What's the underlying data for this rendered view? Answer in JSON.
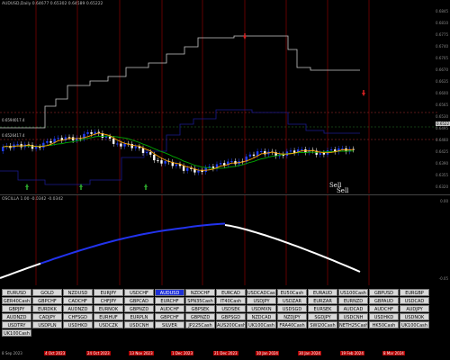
{
  "chart": {
    "title": "AUDUSD,Daily  0.64677 0.65302 0.64589 0.65222",
    "oscillator_title": "OSCILLA 1.00 -0.0342 -0.0342",
    "level_label_1": "0.6594017.4",
    "level_label_2": "0.6526417.4",
    "sell_labels": [
      "Sell",
      "Sell"
    ],
    "price_ticks": [
      "0.6845",
      "0.6810",
      "0.6775",
      "0.6740",
      "0.6705",
      "0.6670",
      "0.6635",
      "0.6600",
      "0.6565",
      "0.6530",
      "0.6495",
      "0.6460",
      "0.6425",
      "0.6390",
      "0.6355",
      "0.6320"
    ],
    "osc_ticks": [
      "0.00",
      "-0.05"
    ],
    "current_price": "0.6522",
    "time_labels": [
      "8 Sep 2023",
      "4 Oct 2023",
      "24 Oct 2023",
      "13 Nov 2023",
      "1 Dec 2023",
      "21 Dec 2023",
      "10 Jan 2024",
      "30 Jan 2024",
      "19 Feb 2024",
      "8 Mar 2024"
    ],
    "colors": {
      "bull_candle": "#2040ff",
      "bear_candle": "#ffffff",
      "envelope": "#c8c8c8",
      "ma_fast": "#ffa500",
      "ma_slow": "#00aa00",
      "osc_line_up": "#2233ee",
      "osc_line_down": "#ffffff",
      "vline": "#8b0000",
      "active_button": "#1d2fd6"
    }
  },
  "symbols": [
    "EURUSD",
    "GOLD",
    "NZDUSD",
    "EURJPY",
    "USDCHF",
    "AUDUSD",
    "NZDCHF",
    "EURCAD",
    "USDCADCash",
    "EU50Cash",
    "EURAUD",
    "US100Cash",
    "GBPUSD",
    "EURGBP",
    "GER40Cash",
    "GBPCHF",
    "CADCHF",
    "CHFJPY",
    "GBPCAD",
    "EURCHF",
    "SPN35Cash",
    "IT40Cash",
    "USDJPY",
    "USDZAR",
    "EURZAR",
    "EURNZD",
    "GBPAUD",
    "USDCAD",
    "GBPJPY",
    "EURDKK",
    "AUDNZD",
    "EURNOK",
    "GBPNZD",
    "AUDCHF",
    "GBPSEK",
    "USDSEK",
    "USDMXN",
    "USDSGD",
    "EURSEK",
    "AUDCAD",
    "AUDCHF",
    "AUDJPY",
    "AUDNZD",
    "CADJPY",
    "CHFSGD",
    "EURHUF",
    "EURPLN",
    "GBPCHF",
    "GBPNZD",
    "GBPSGD",
    "NZDCAD",
    "NZDJPY",
    "SGDJPY",
    "USDCNH",
    "USDHKD",
    "USDNOK",
    "USDTRY",
    "USDPLN",
    "USDHKD",
    "USDCZK",
    "USDCNH",
    "SILVER",
    "JP225Cash",
    "AUS200Cash",
    "UK100Cash",
    "FRA40Cash",
    "SWI20Cash",
    "NETH25Cash",
    "HK50Cash",
    "UK100Cash"
  ],
  "active_symbol": "AUDUSD"
}
